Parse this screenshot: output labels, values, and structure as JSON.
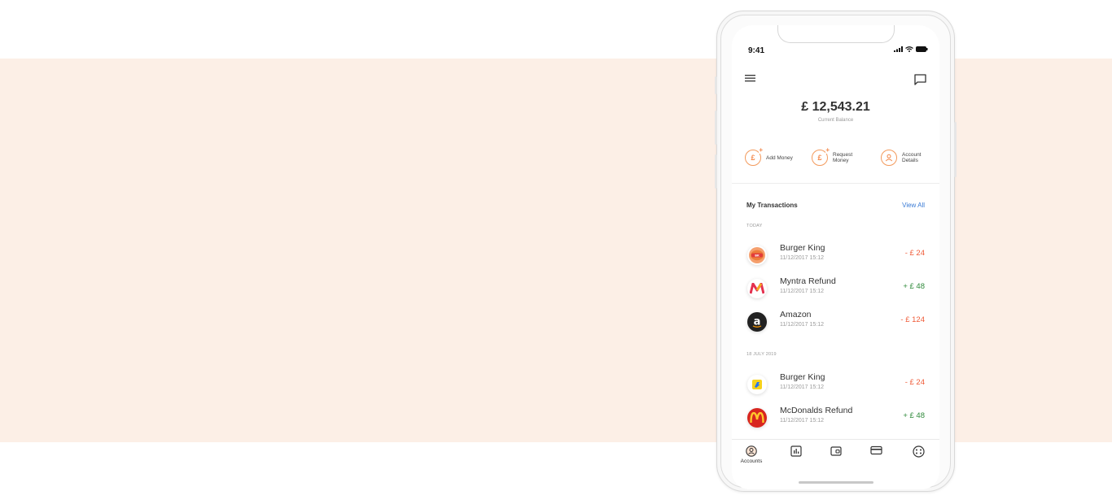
{
  "colors": {
    "background_band": "#fcefe6",
    "accent": "#f3884a",
    "negative": "#ef5b38",
    "positive": "#2f8a3b",
    "link": "#3a7bd5"
  },
  "status_bar": {
    "time": "9:41",
    "icons": [
      "signal-icon",
      "wifi-icon",
      "battery-icon"
    ]
  },
  "header": {
    "menu_icon": "menu-icon",
    "chat_icon": "chat-icon"
  },
  "balance": {
    "amount": "£ 12,543.21",
    "caption": "Current Balance"
  },
  "actions": [
    {
      "label": "Add Money",
      "icon": "add-money-icon"
    },
    {
      "label": "Request Money",
      "icon": "request-money-icon"
    },
    {
      "label": "Account Details",
      "icon": "account-details-icon"
    }
  ],
  "transactions": {
    "title": "My Transactions",
    "view_all": "View All",
    "groups": [
      {
        "label": "TODAY",
        "items": [
          {
            "name": "Burger King",
            "date": "11/12/2017 15:12",
            "amount": "- £ 24",
            "type": "debit",
            "logo": "burger-king-logo"
          },
          {
            "name": "Myntra Refund",
            "date": "11/12/2017 15:12",
            "amount": "+ £ 48",
            "type": "credit",
            "logo": "myntra-logo"
          },
          {
            "name": "Amazon",
            "date": "11/12/2017 15:12",
            "amount": "- £ 124",
            "type": "debit",
            "logo": "amazon-logo"
          }
        ]
      },
      {
        "label": "18 JULY 2019",
        "items": [
          {
            "name": "Burger King",
            "date": "11/12/2017 15:12",
            "amount": "- £ 24",
            "type": "debit",
            "logo": "flipkart-logo"
          },
          {
            "name": "McDonalds Refund",
            "date": "11/12/2017 15:12",
            "amount": "+ £ 48",
            "type": "credit",
            "logo": "mcdonalds-logo"
          }
        ]
      }
    ]
  },
  "tabbar": {
    "active": "Accounts",
    "tabs": [
      {
        "label": "Accounts",
        "icon": "accounts-icon"
      },
      {
        "label": "",
        "icon": "stats-icon"
      },
      {
        "label": "",
        "icon": "wallet-icon"
      },
      {
        "label": "",
        "icon": "card-icon"
      },
      {
        "label": "",
        "icon": "more-icon"
      }
    ]
  }
}
